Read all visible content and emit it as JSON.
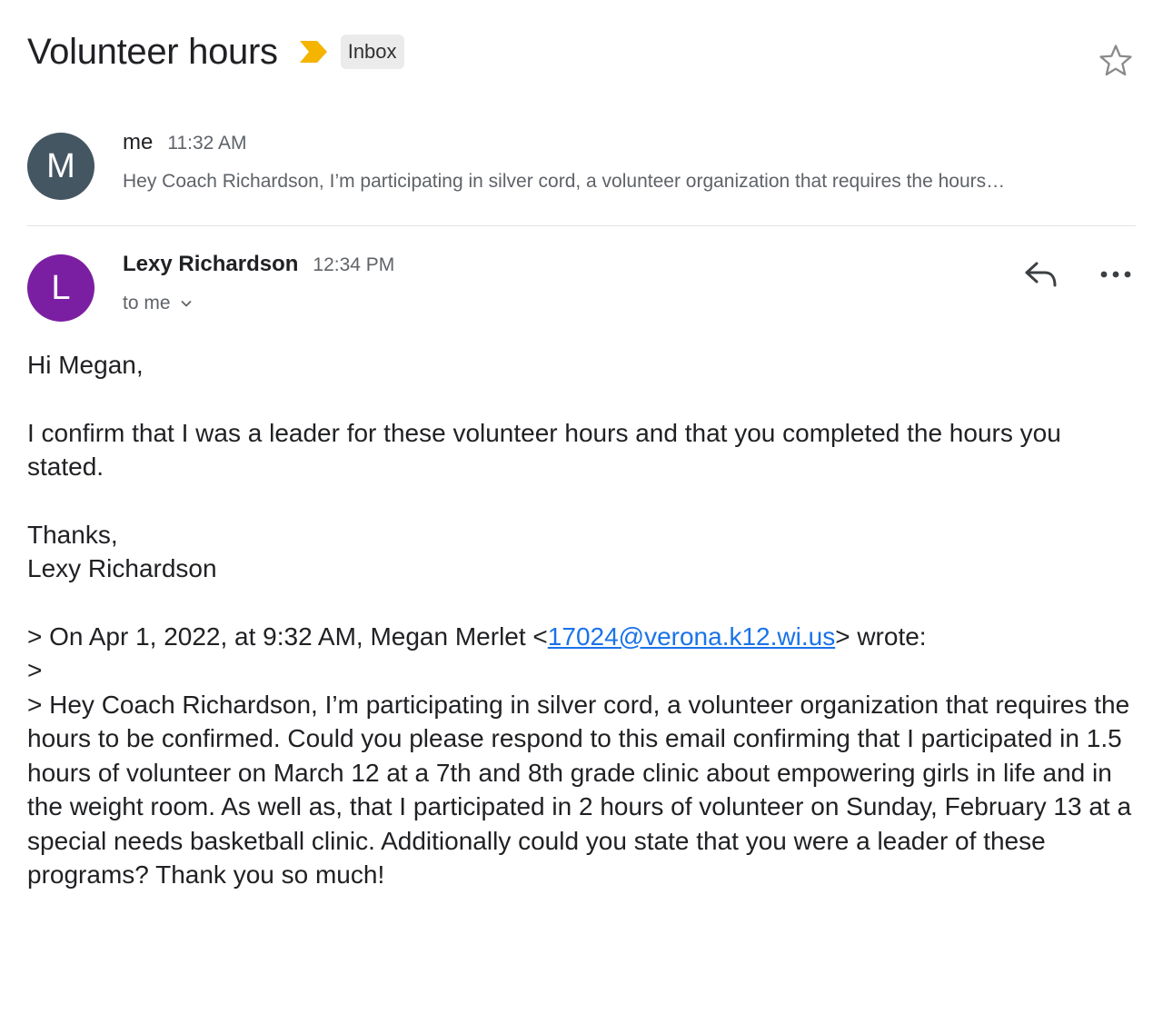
{
  "thread": {
    "subject": "Volunteer hours",
    "label": "Inbox",
    "important_color": "#f4b400"
  },
  "message1": {
    "avatar_letter": "M",
    "avatar_color": "#445662",
    "sender": "me",
    "time": "11:32 AM",
    "snippet": "Hey Coach Richardson, I’m participating in silver cord, a volunteer organization that requires the hours…"
  },
  "message2": {
    "avatar_letter": "L",
    "avatar_color": "#7b1fa2",
    "sender": "Lexy Richardson",
    "time": "12:34 PM",
    "recipients": "to me",
    "body": {
      "greeting": "Hi Megan,",
      "paragraph": "I confirm that I was a leader for these volunteer hours and that you completed the hours you stated.",
      "signoff": "Thanks,",
      "signature": "Lexy Richardson",
      "quote_header_prefix": "> On Apr 1, 2022, at 9:32 AM, Megan Merlet <",
      "quote_email": "17024@verona.k12.wi.us",
      "quote_header_suffix": "> wrote:",
      "quote_blank": ">",
      "quote_text": "> Hey Coach Richardson, I’m participating in silver cord, a volunteer organization that requires the hours to be confirmed. Could you please respond to this email confirming that I participated in 1.5 hours of volunteer on March 12 at a 7th and 8th grade clinic about empowering girls in life and in the weight room. As well as, that I participated in 2 hours of volunteer on Sunday, February 13 at a special needs basketball clinic. Additionally could you state that you were a leader of these programs? Thank you so much!"
    }
  },
  "icons": {
    "star": "star-outline-icon",
    "importance": "importance-marker-icon",
    "reply": "reply-icon",
    "more": "more-horizontal-icon",
    "chevron": "chevron-down-icon"
  }
}
